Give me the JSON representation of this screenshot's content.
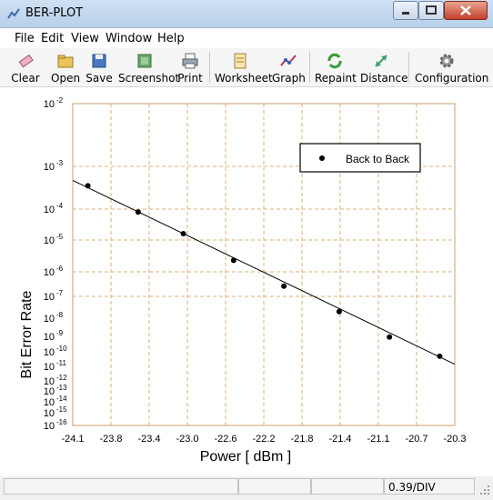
{
  "window": {
    "title": "BER-PLOT",
    "accent": "#c4402a"
  },
  "menu": [
    "File",
    "Edit",
    "View",
    "Window",
    "Help"
  ],
  "toolbar": [
    {
      "label": "Clear",
      "icon": "eraser-icon"
    },
    {
      "label": "Open",
      "icon": "open-folder-icon"
    },
    {
      "label": "Save",
      "icon": "floppy-disk-icon"
    },
    {
      "label": "Screenshot",
      "icon": "screenshot-icon"
    },
    {
      "label": "Print",
      "icon": "printer-icon"
    },
    {
      "label": "Worksheet",
      "icon": "worksheet-icon"
    },
    {
      "label": "Graph",
      "icon": "graph-icon"
    },
    {
      "label": "Repaint",
      "icon": "repaint-icon"
    },
    {
      "label": "Distance",
      "icon": "distance-arrows-icon"
    },
    {
      "label": "Configuration",
      "icon": "gear-icon"
    }
  ],
  "status": {
    "div_label": "0.39/DIV"
  },
  "chart_data": {
    "type": "scatter",
    "xlabel": "Power [ dBm ]",
    "ylabel": "Bit Error Rate",
    "xlim": [
      -24.1,
      -20.3
    ],
    "x_ticks": [
      "-24.1",
      "-23.8",
      "-23.4",
      "-23.0",
      "-22.6",
      "-22.2",
      "-21.8",
      "-21.4",
      "-21.1",
      "-20.7",
      "-20.3"
    ],
    "y_ticks": [
      {
        "exp": "-2"
      },
      {
        "exp": "-3"
      },
      {
        "exp": "-4"
      },
      {
        "exp": "-5"
      },
      {
        "exp": "-6"
      },
      {
        "exp": "-7"
      },
      {
        "exp": "-8"
      },
      {
        "exp": "-9"
      },
      {
        "exp": "-10"
      },
      {
        "exp": "-11"
      },
      {
        "exp": "-12"
      },
      {
        "exp": "-13"
      },
      {
        "exp": "-14"
      },
      {
        "exp": "-15"
      },
      {
        "exp": "-16"
      }
    ],
    "y_tick_base": "10",
    "grid": true,
    "legend_position": "top-right",
    "series": [
      {
        "name": "Back to Back",
        "marker": "filled-circle",
        "color": "#000000",
        "points": [
          {
            "x": -23.95,
            "y": 0.00035
          },
          {
            "x": -23.45,
            "y": 8e-05
          },
          {
            "x": -23.0,
            "y": 1.6e-05
          },
          {
            "x": -22.5,
            "y": 2.3e-06
          },
          {
            "x": -22.0,
            "y": 2.6e-07
          },
          {
            "x": -21.45,
            "y": 2e-08
          },
          {
            "x": -20.95,
            "y": 9e-10
          },
          {
            "x": -20.45,
            "y": 5e-11
          }
        ]
      }
    ],
    "fit_line": {
      "x": [
        -24.1,
        -20.3
      ],
      "y": [
        0.00047,
        1.4e-11
      ]
    }
  }
}
